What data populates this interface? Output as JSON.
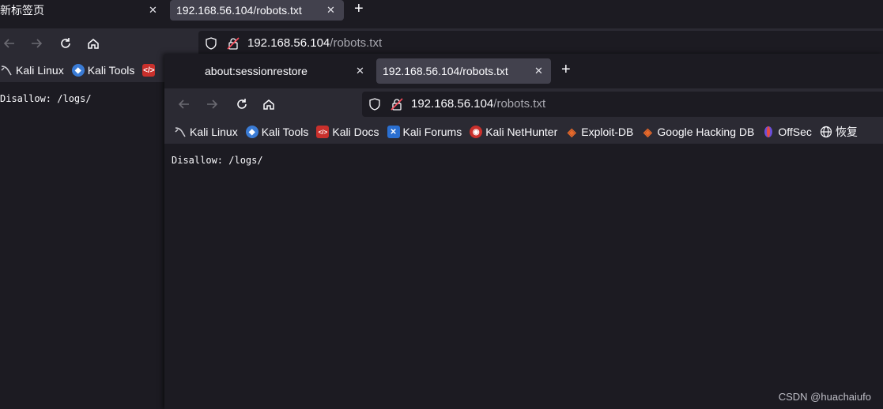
{
  "back_window": {
    "tabs": [
      {
        "title": "新标签页"
      },
      {
        "title": "192.168.56.104/robots.txt"
      }
    ],
    "url": {
      "host": "192.168.56.104",
      "path": "/robots.txt"
    },
    "bookmarks": [
      "Kali Linux",
      "Kali Tools"
    ],
    "content": "Disallow: /logs/"
  },
  "front_window": {
    "tabs": [
      {
        "title": "about:sessionrestore"
      },
      {
        "title": "192.168.56.104/robots.txt"
      }
    ],
    "url": {
      "host": "192.168.56.104",
      "path": "/robots.txt"
    },
    "bookmarks": [
      "Kali Linux",
      "Kali Tools",
      "Kali Docs",
      "Kali Forums",
      "Kali NetHunter",
      "Exploit-DB",
      "Google Hacking DB",
      "OffSec",
      "恢复"
    ],
    "content": "Disallow: /logs/"
  },
  "watermark": "CSDN @huachaiufo",
  "icons": {
    "close": "close-icon",
    "new_tab": "plus-icon",
    "back": "back-arrow-icon",
    "forward": "forward-arrow-icon",
    "reload": "reload-icon",
    "home": "home-icon",
    "shield": "shield-icon",
    "insecure_lock": "insecure-lock-icon"
  }
}
